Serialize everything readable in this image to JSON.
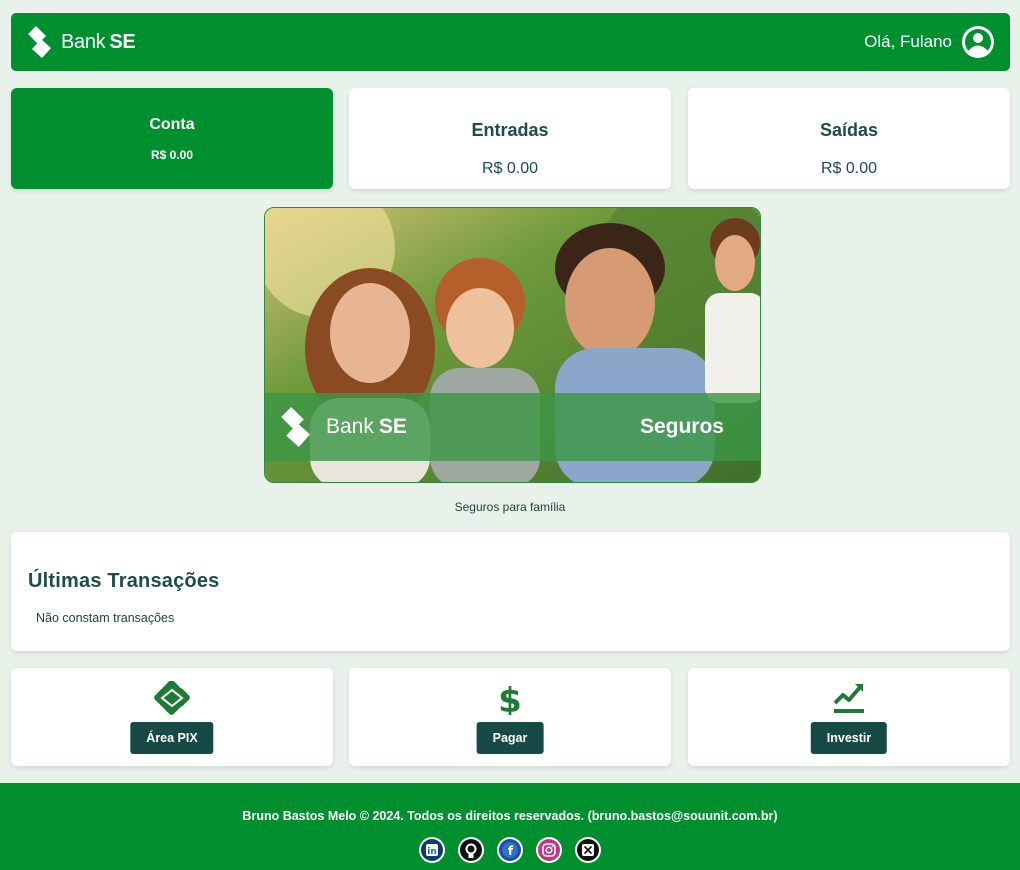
{
  "header": {
    "brand_light": "Bank",
    "brand_bold": "SE",
    "greeting": "Olá, Fulano",
    "user_icon": "user-circle-icon"
  },
  "summary": [
    {
      "title": "Conta",
      "value": "R$ 0.00"
    },
    {
      "title": "Entradas",
      "value": "R$ 0.00"
    },
    {
      "title": "Saídas",
      "value": "R$ 0.00"
    }
  ],
  "banner": {
    "brand_light": "Bank",
    "brand_bold": "SE",
    "label": "Seguros",
    "caption": "Seguros para família"
  },
  "transactions": {
    "title": "Últimas Transações",
    "empty_text": "Não constam transações"
  },
  "actions": [
    {
      "label": "Área PIX",
      "icon": "pix-icon"
    },
    {
      "label": "Pagar",
      "icon": "dollar-icon"
    },
    {
      "label": "Investir",
      "icon": "chart-line-icon"
    }
  ],
  "footer": {
    "copyright": "Bruno Bastos Melo © 2024. Todos os direitos reservados. (bruno.bastos@souunit.com.br)",
    "socials": [
      "linkedin-icon",
      "github-icon",
      "facebook-icon",
      "instagram-icon",
      "x-icon"
    ]
  },
  "colors": {
    "brand_green": "#008f2f",
    "dark_teal": "#174a47",
    "background": "#e8f1ea"
  }
}
